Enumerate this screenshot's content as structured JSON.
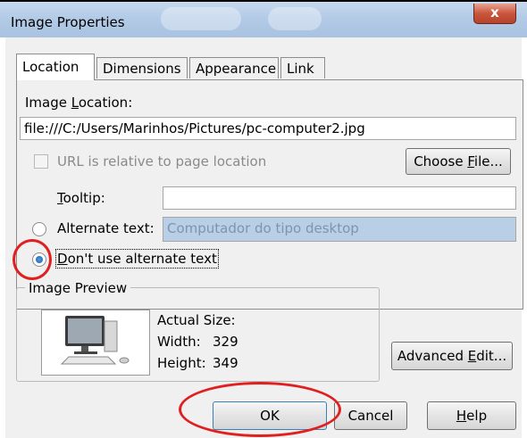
{
  "window": {
    "title": "Image Properties",
    "close_glyph": "x"
  },
  "tabs": [
    {
      "label": "Location",
      "active": true
    },
    {
      "label": "Dimensions",
      "active": false
    },
    {
      "label": "Appearance",
      "active": false
    },
    {
      "label": "Link",
      "active": false
    }
  ],
  "location": {
    "image_location_label_pre": "Image ",
    "image_location_label_underlined": "L",
    "image_location_label_post": "ocation:",
    "image_location_value": "file:///C:/Users/Marinhos/Pictures/pc-computer2.jpg",
    "relative_checkbox_label": "URL is relative to page location",
    "relative_checkbox_checked": false,
    "choose_file_pre": "Choose ",
    "choose_file_underlined": "F",
    "choose_file_post": "ile...",
    "tooltip_label_underlined": "T",
    "tooltip_label_post": "ooltip:",
    "tooltip_value": "",
    "alt_text_radio_label": "Alternate text:",
    "alt_text_value": "Computador do tipo desktop",
    "alt_text_checked": false,
    "no_alt_radio_label_underlined": "D",
    "no_alt_radio_label_post": "on't use alternate text",
    "no_alt_checked": true
  },
  "preview": {
    "group_title": "Image Preview",
    "actual_size_label": "Actual Size:",
    "width_label": "Width:",
    "width_value": "329",
    "height_label": "Height:",
    "height_value": "349"
  },
  "buttons": {
    "advanced_edit_pre": "Advanced ",
    "advanced_edit_underlined": "E",
    "advanced_edit_post": "dit...",
    "ok": "OK",
    "cancel": "Cancel",
    "help_underlined": "H",
    "help_post": "elp"
  },
  "colors": {
    "annotation": "#e02020",
    "disabled_field": "#b8cfe5",
    "title_gradient_start": "#c7d9ee"
  }
}
